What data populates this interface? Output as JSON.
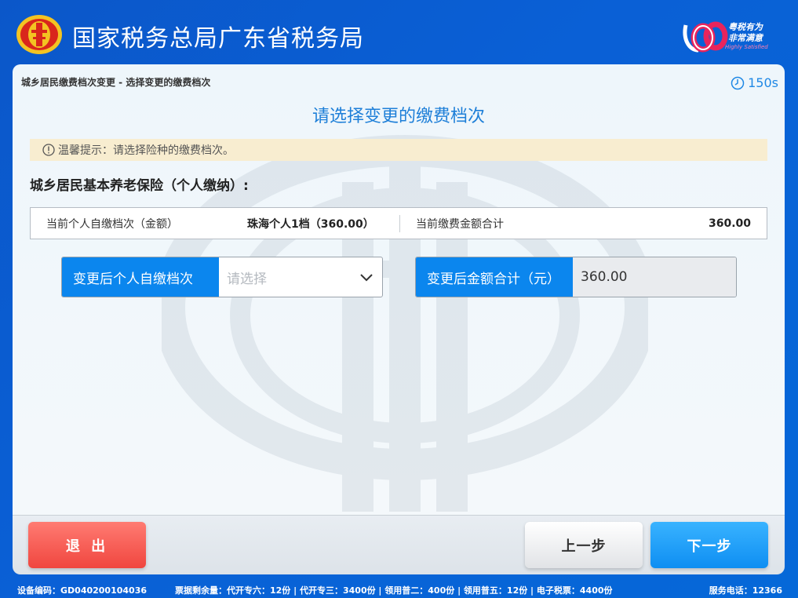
{
  "header": {
    "title": "国家税务总局广东省税务局",
    "brand_line1": "粤税有为",
    "brand_line2": "非常满意",
    "brand_en": "Highly Satisfied"
  },
  "panel": {
    "breadcrumb": "城乡居民缴费档次变更  -  选择变更的缴费档次",
    "timer": "150s",
    "heading": "请选择变更的缴费档次",
    "notice": "温馨提示：请选择险种的缴费档次。",
    "section_title": "城乡居民基本养老保险（个人缴纳）:",
    "current": {
      "level_label": "当前个人自缴档次（金额）",
      "level_value": "珠海个人1档（360.00）",
      "total_label": "当前缴费金额合计",
      "total_value": "360.00"
    },
    "new_level": {
      "label": "变更后个人自缴档次",
      "placeholder": "请选择"
    },
    "new_total": {
      "label": "变更后金额合计（元）",
      "value": "360.00"
    }
  },
  "buttons": {
    "exit": "退 出",
    "prev": "上一步",
    "next": "下一步"
  },
  "statusbar": {
    "device": "设备编码：GD040200104036",
    "stock": "票据剩余量：代开专六：12份 | 代开专三：3400份 | 领用普二：400份 | 领用普五：12份 | 电子税票：4400份",
    "phone": "服务电话：12366"
  },
  "colors": {
    "background": "#0a60d6",
    "accent": "#0b86ee",
    "heading": "#1e7fd8",
    "exit_button": "#f0463f",
    "next_button": "#0e8ef2",
    "notice_bg": "#f8edd0"
  },
  "icons": {
    "emblem": "tax-emblem-icon",
    "brand": "brand-logo-icon",
    "timer": "clock-icon",
    "notice": "info-icon",
    "dropdown": "chevron-down-icon"
  }
}
